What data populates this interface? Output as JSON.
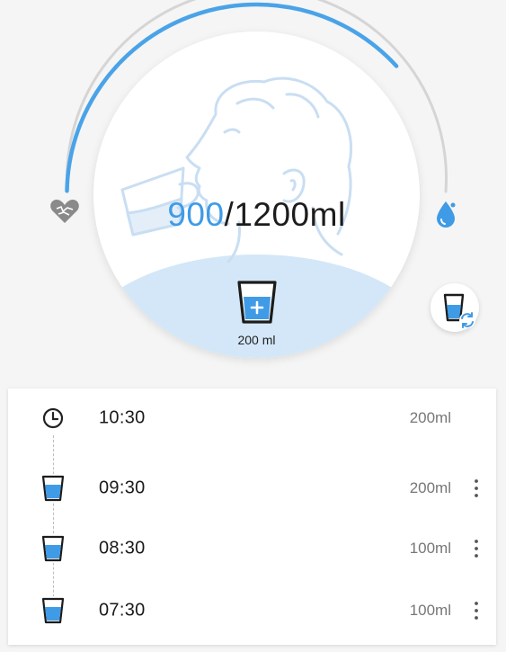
{
  "intake": {
    "current": "900",
    "goal_text": "/1200ml",
    "progress_fraction": 0.75
  },
  "add_button": {
    "cup_size_label": "200 ml"
  },
  "icons": {
    "ring_start": "heart-icon",
    "ring_end": "water-drop-icon",
    "add": "cup-plus-icon",
    "switch_cup": "cup-switch-icon",
    "next_reminder": "clock-icon",
    "record": "water-cup-icon",
    "more": "more-vert-icon"
  },
  "colors": {
    "accent": "#4aa3e8",
    "track": "#d5d5d5",
    "water_light": "#d3e7f8"
  },
  "history": {
    "items": [
      {
        "time": "10:30",
        "amount": "200ml",
        "type": "reminder",
        "icon": "clock-icon"
      },
      {
        "time": "09:30",
        "amount": "200ml",
        "type": "record",
        "icon": "water-cup-icon"
      },
      {
        "time": "08:30",
        "amount": "100ml",
        "type": "record",
        "icon": "water-cup-icon"
      },
      {
        "time": "07:30",
        "amount": "100ml",
        "type": "record",
        "icon": "water-cup-icon"
      }
    ]
  }
}
